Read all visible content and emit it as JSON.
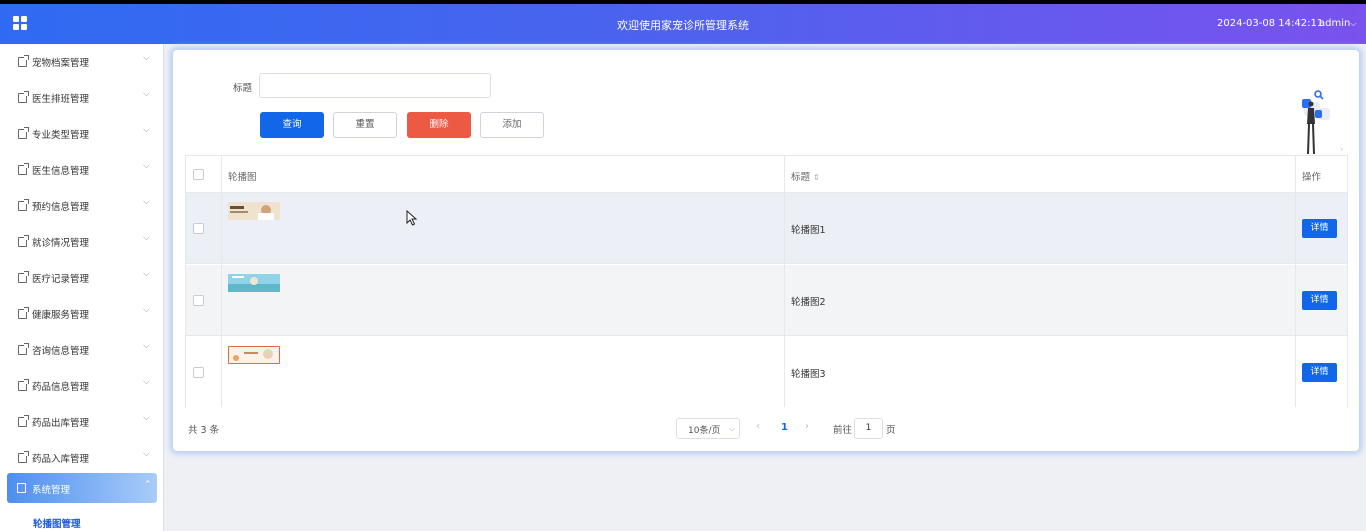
{
  "header": {
    "title": "欢迎使用家宠诊所管理系统",
    "datetime": "2024-03-08 14:42:11",
    "user": "admin",
    "user_caret": "⌵"
  },
  "sidebar": {
    "items": [
      {
        "label": "宠物档案管理"
      },
      {
        "label": "医生排班管理"
      },
      {
        "label": "专业类型管理"
      },
      {
        "label": "医生信息管理"
      },
      {
        "label": "预约信息管理"
      },
      {
        "label": "就诊情况管理"
      },
      {
        "label": "医疗记录管理"
      },
      {
        "label": "健康服务管理"
      },
      {
        "label": "咨询信息管理"
      },
      {
        "label": "药品信息管理"
      },
      {
        "label": "药品出库管理"
      },
      {
        "label": "药品入库管理"
      }
    ],
    "active": {
      "label": "系统管理"
    },
    "submenu": {
      "label": "轮播图管理"
    },
    "chevron_down": "⌵",
    "chevron_up": "⌃"
  },
  "search": {
    "label": "标题",
    "value": "",
    "placeholder": ""
  },
  "buttons": {
    "query": "查询",
    "reset": "重置",
    "delete": "删除",
    "add": "添加"
  },
  "table": {
    "columns": {
      "image": "轮播图",
      "title": "标题",
      "sort_icon": "⇕",
      "actions": "操作"
    },
    "rows": [
      {
        "title": "轮播图1",
        "action": "详情"
      },
      {
        "title": "轮播图2",
        "action": "详情"
      },
      {
        "title": "轮播图3",
        "action": "详情"
      }
    ]
  },
  "pagination": {
    "total": "共 3 条",
    "page_size": "10条/页",
    "dropdown": "⌵",
    "prev": "‹",
    "current": "1",
    "next": "›",
    "goto_label": "前往",
    "goto_value": "1",
    "goto_unit": "页"
  },
  "colors": {
    "primary": "#1267e9",
    "danger": "#ec5a44",
    "header_gradient_start": "#2f6bf2",
    "header_gradient_end": "#7a52ee"
  }
}
